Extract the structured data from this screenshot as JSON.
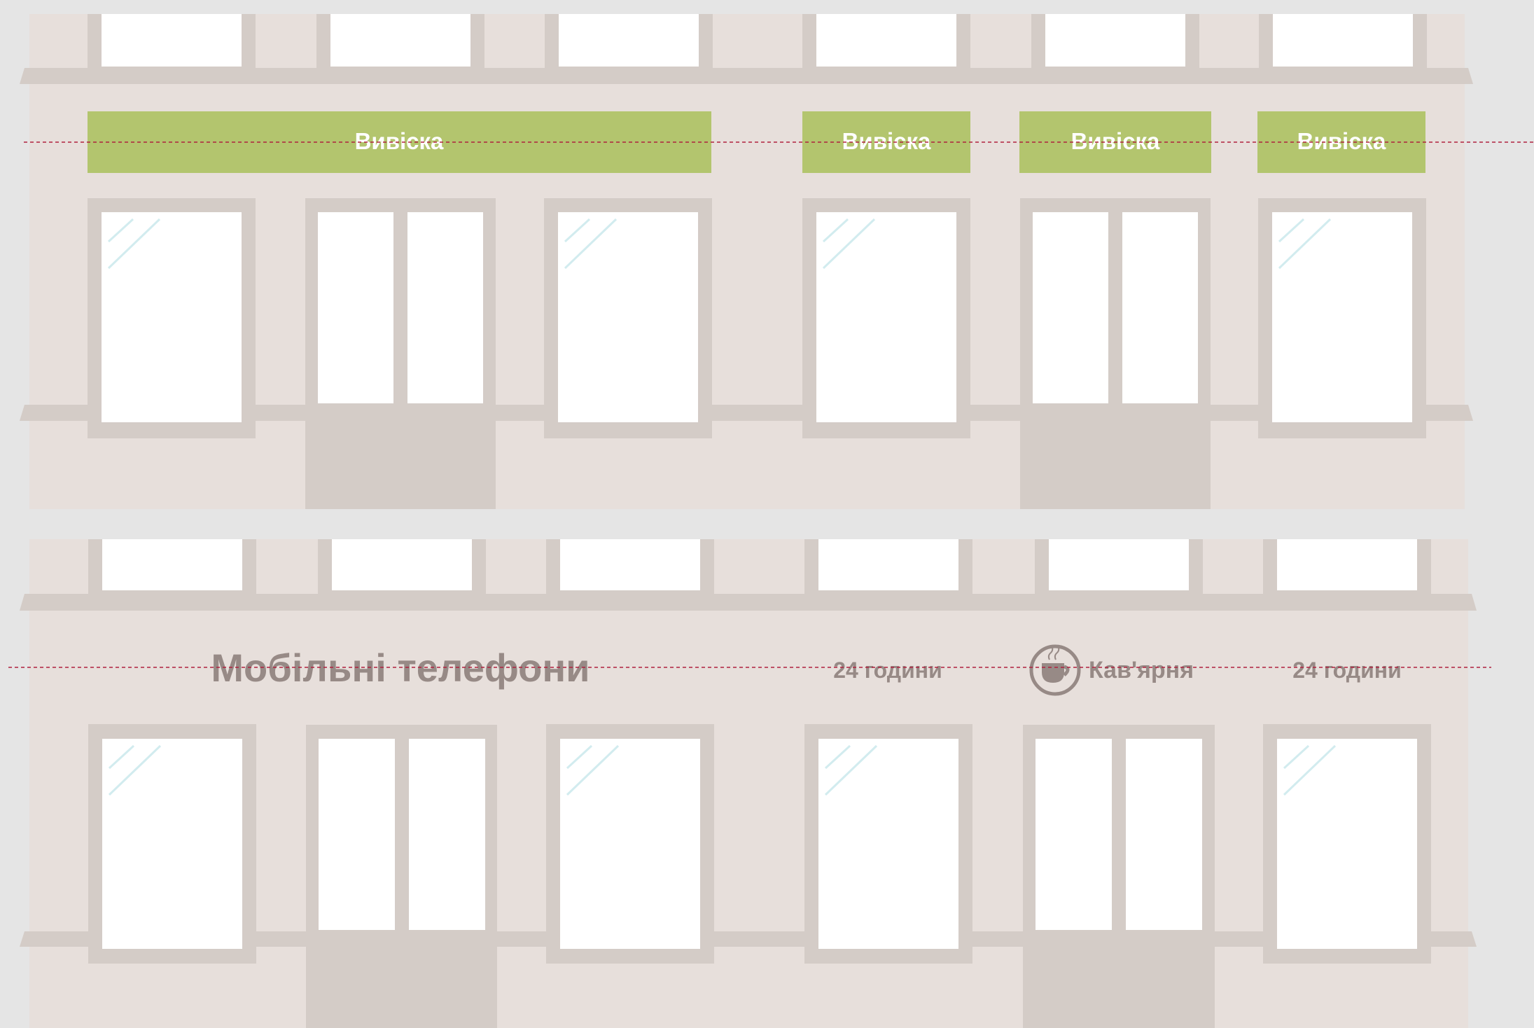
{
  "colors": {
    "page_background": "#e5e5e5",
    "facade": "#e7dfdb",
    "frame": "#d4ccc7",
    "glass": "#ffffff",
    "glass_glint": "#d2ecef",
    "sign_panel": "#b3c56e",
    "sign_text": "#ffffff",
    "lettering_text": "#978a86",
    "guide_line": "#b0213e"
  },
  "top_facade": {
    "signs": [
      {
        "text": "Вивіска"
      },
      {
        "text": "Вивіска"
      },
      {
        "text": "Вивіска"
      },
      {
        "text": "Вивіска"
      }
    ]
  },
  "bottom_facade": {
    "labels": [
      {
        "text": "Мобільні телефони"
      },
      {
        "text": "24 години"
      },
      {
        "text": "Кав'ярня",
        "icon": "coffee-cup-icon"
      },
      {
        "text": "24 години"
      }
    ]
  }
}
